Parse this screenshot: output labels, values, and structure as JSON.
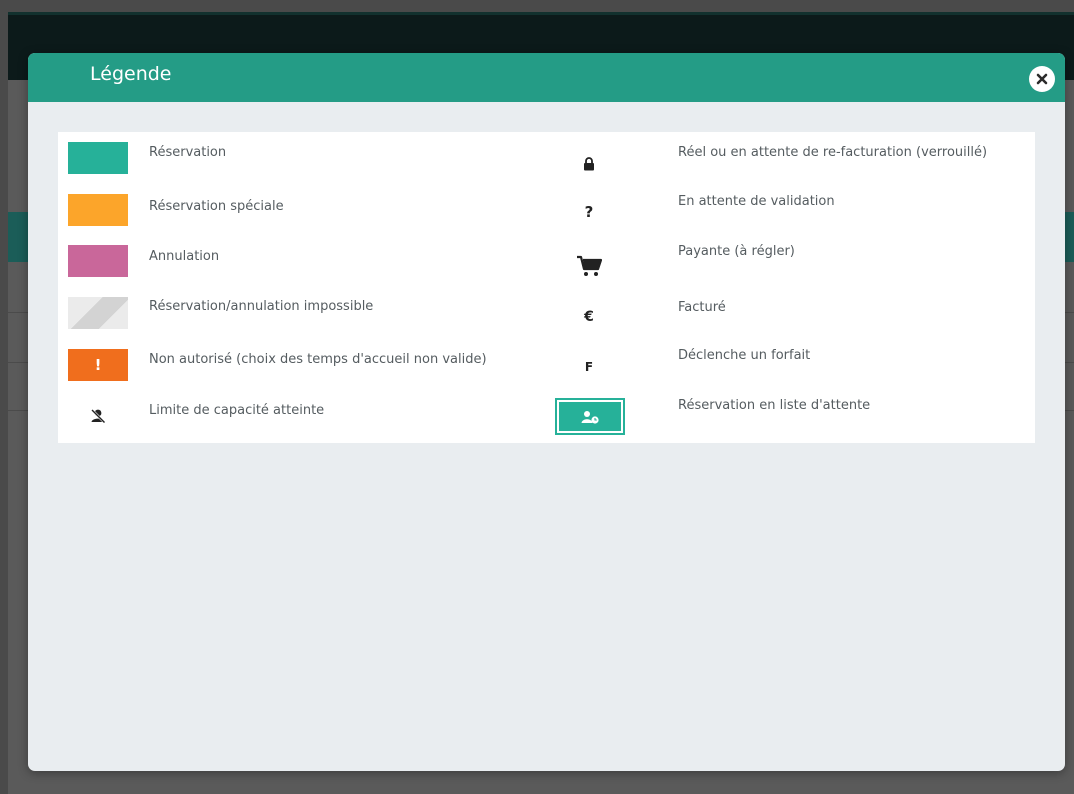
{
  "modal": {
    "title": "Légende"
  },
  "legend": {
    "left": [
      {
        "label": "Réservation",
        "color": "#26b199",
        "icon": "teal-swatch"
      },
      {
        "label": "Réservation spéciale",
        "color": "#fca52a",
        "icon": "orange-swatch"
      },
      {
        "label": "Annulation",
        "color": "#c9679a",
        "icon": "pink-swatch"
      },
      {
        "label": "Réservation/annulation impossible",
        "color": "#dcdcdc",
        "icon": "hatched-swatch"
      },
      {
        "label": "Non autorisé (choix des temps d'accueil non valide)",
        "color": "#f06e1d",
        "icon": "exclamation-icon",
        "glyph": "!"
      },
      {
        "label": "Limite de capacité atteinte",
        "icon": "user-slash-icon"
      }
    ],
    "right": [
      {
        "label": "Réel ou en attente de re-facturation (verrouillé)",
        "icon": "lock-icon"
      },
      {
        "label": "En attente de validation",
        "icon": "question-icon",
        "glyph": "?"
      },
      {
        "label": "Payante (à régler)",
        "icon": "cart-icon"
      },
      {
        "label": "Facturé",
        "icon": "euro-icon",
        "glyph": "€"
      },
      {
        "label": "Déclenche un forfait",
        "icon": "forfait-icon",
        "glyph": "F"
      },
      {
        "label": "Réservation en liste d'attente",
        "icon": "waitlist-icon",
        "color": "#26b199"
      }
    ]
  },
  "colors": {
    "header": "#249c86",
    "accent": "#26b199"
  }
}
